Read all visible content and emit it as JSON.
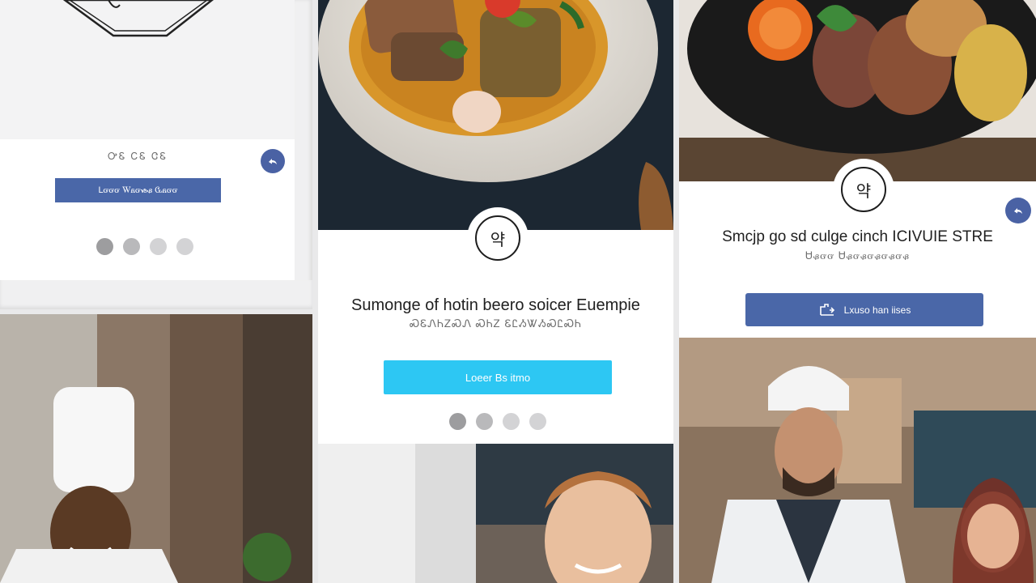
{
  "colors": {
    "page_bg": "#e9e9ea",
    "card_bg": "#ffffff",
    "navy_button": "#4a67a8",
    "cyan_button": "#2dc7f3",
    "share_badge": "#4a62a4",
    "dot_gray": "#b9b9bb"
  },
  "tile_top_left": {
    "logo_icon": "chef-hat-octagon-logo",
    "small_text": "ᎤᏋ ᏟᏋ ᏣᏋ",
    "button_label": "Lᏻᏻᏻ Ꮃᏺᏻᏹᏸ Ꮹᏺᏻᏻ",
    "share_icon": "share-icon",
    "dots": 4
  },
  "tile_center": {
    "photo": "plated-curry-dish",
    "logo_glyph": "약",
    "heading": "Sumonge of hotin beero soicer Euempie",
    "subheading": "ᏍᏋᏁᏂᏃᏍᏁ ᏍᏂᏃ ᏋᏝᏱᏔᏱᏍᏝᏍᏂ",
    "button_label": "Loeer Bs itmo",
    "dots": 4
  },
  "tile_right": {
    "photo": "grilled-meat-platter",
    "logo_glyph": "약",
    "heading": "Smcjp go sd culge cinch ICIVUIE STRE",
    "subheading": "Ꮜᏸᏻᏻ Ꮜᏸᏻᏸᏻᏸᏻᏸᏻᏸ",
    "button_label": "Lxuso han iises",
    "button_icon": "order-icon",
    "share_icon": "share-icon"
  },
  "photos": {
    "bottom_left": "smiling-chef-in-toque",
    "bottom_center": "smiling-man-in-kitchen",
    "bottom_right": "chef-and-woman-in-restaurant"
  }
}
